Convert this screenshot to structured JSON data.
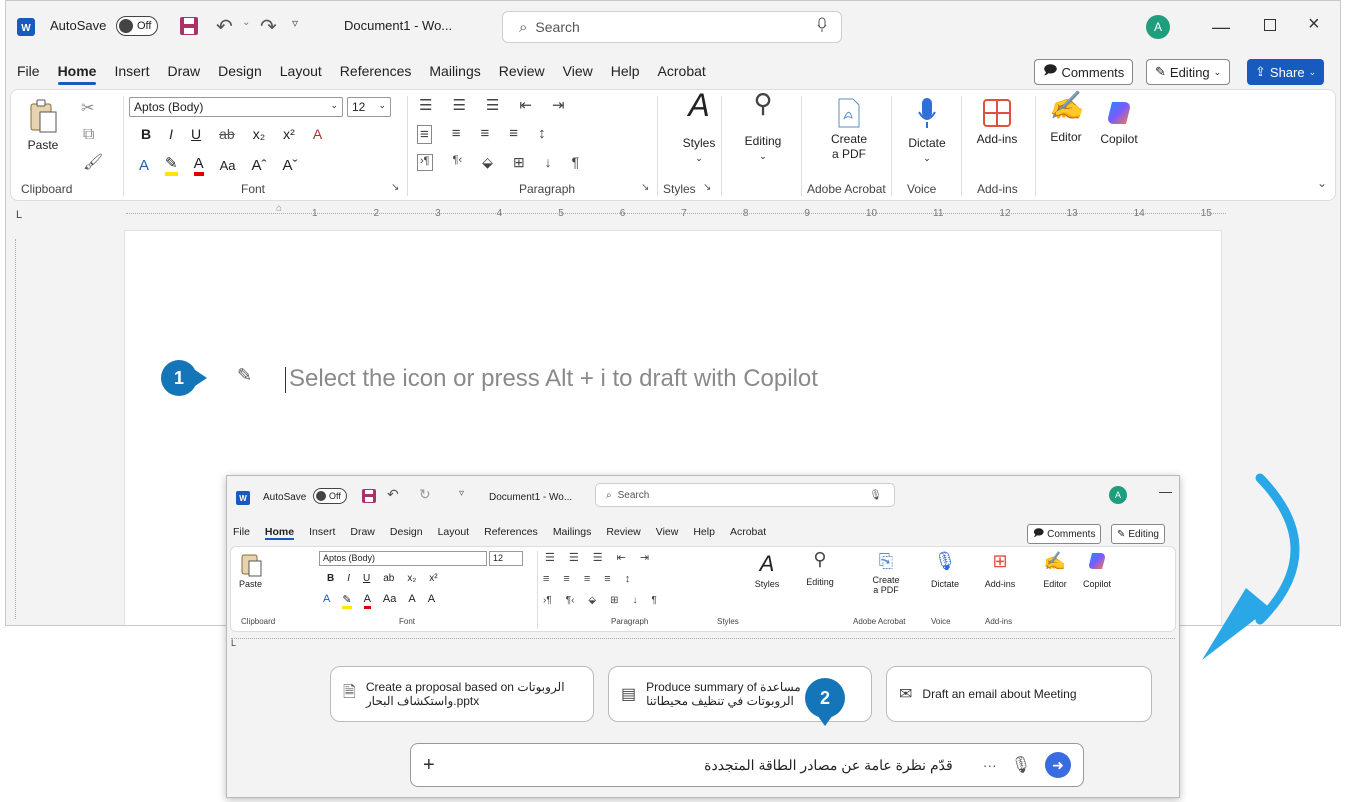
{
  "main_window": {
    "autosave_label": "AutoSave",
    "autosave_state": "Off",
    "doc_title": "Document1 - Wo...",
    "search_placeholder": "Search",
    "avatar_initial": "A",
    "menu": [
      "File",
      "Home",
      "Insert",
      "Draw",
      "Design",
      "Layout",
      "References",
      "Mailings",
      "Review",
      "View",
      "Help",
      "Acrobat"
    ],
    "comments_label": "Comments",
    "editing_label": "Editing",
    "share_label": "Share",
    "ribbon": {
      "paste": "Paste",
      "font_name": "Aptos (Body)",
      "font_size": "12",
      "styles": "Styles",
      "editing": "Editing",
      "create_pdf_line1": "Create",
      "create_pdf_line2": "a PDF",
      "dictate": "Dictate",
      "addins": "Add-ins",
      "editor": "Editor",
      "copilot": "Copilot",
      "groups": {
        "clipboard": "Clipboard",
        "font": "Font",
        "paragraph": "Paragraph",
        "styles": "Styles",
        "adobe": "Adobe Acrobat",
        "voice": "Voice",
        "addins": "Add-ins"
      }
    },
    "ruler_numbers": [
      "1",
      "2",
      "3",
      "4",
      "5",
      "6",
      "7",
      "8",
      "9",
      "10",
      "11",
      "12",
      "13",
      "14",
      "15"
    ],
    "placeholder_text": "Select the icon or press Alt + i to draft with Copilot"
  },
  "badges": {
    "one": "1",
    "two": "2"
  },
  "inset": {
    "suggestions": [
      {
        "text_line1": "Create a proposal based on الروبوتات",
        "text_line2": "واستكشاف البحار.pptx"
      },
      {
        "text_line1": "Produce summary of مساعدة",
        "text_line2": "الروبوتات في تنظيف محيطاتنا"
      },
      {
        "text_line1": "Draft an email about Meeting",
        "text_line2": ""
      }
    ],
    "prompt_text": "قدّم نظرة عامة عن مصادر الطاقة المتجددة",
    "more_label": "···"
  },
  "colors": {
    "accent": "#185abd",
    "badge": "#1476b8",
    "arrow": "#29a7e6",
    "avatar": "#1f9e7e",
    "copilot": "#7a5cff"
  }
}
